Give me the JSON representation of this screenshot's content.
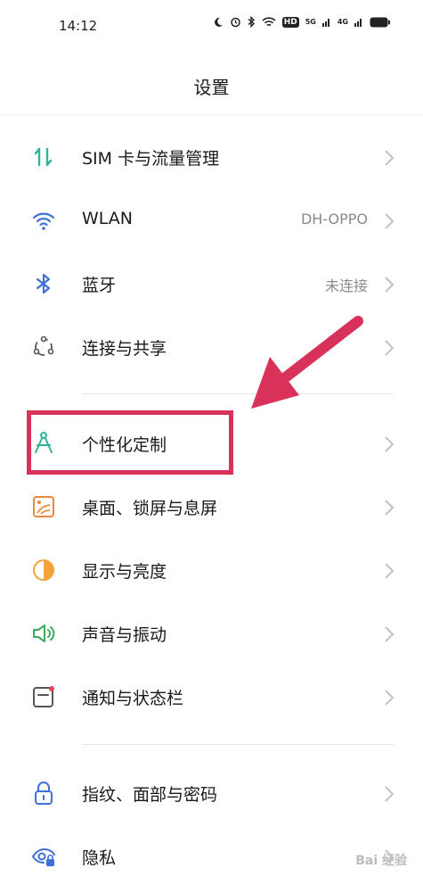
{
  "status_bar": {
    "time": "14:12",
    "hd": "HD",
    "signal1": "5G",
    "signal2": "4G"
  },
  "header": {
    "title": "设置"
  },
  "items": [
    {
      "label": "SIM 卡与流量管理",
      "value": "",
      "icon": "sim-data-icon",
      "color": "#2fb39a"
    },
    {
      "label": "WLAN",
      "value": "DH-OPPO",
      "icon": "wifi-icon",
      "color": "#3f6fd9"
    },
    {
      "label": "蓝牙",
      "value": "未连接",
      "icon": "bluetooth-icon",
      "color": "#3f6fd9"
    },
    {
      "label": "连接与共享",
      "value": "",
      "icon": "connection-share-icon",
      "color": "#555555"
    },
    {
      "label": "个性化定制",
      "value": "",
      "icon": "personalization-icon",
      "color": "#2fb39a"
    },
    {
      "label": "桌面、锁屏与息屏",
      "value": "",
      "icon": "wallpaper-icon",
      "color": "#e88a3a"
    },
    {
      "label": "显示与亮度",
      "value": "",
      "icon": "display-brightness-icon",
      "color": "#f2a33b"
    },
    {
      "label": "声音与振动",
      "value": "",
      "icon": "sound-icon",
      "color": "#3ea85d"
    },
    {
      "label": "通知与状态栏",
      "value": "",
      "icon": "notification-icon",
      "color": "#555555"
    },
    {
      "label": "指纹、面部与密码",
      "value": "",
      "icon": "lock-icon",
      "color": "#3f6fd9"
    },
    {
      "label": "隐私",
      "value": "",
      "icon": "privacy-icon",
      "color": "#3f6fd9"
    }
  ],
  "annotation": {
    "highlight_color": "#d8325a"
  },
  "watermark": "Bai 经验"
}
